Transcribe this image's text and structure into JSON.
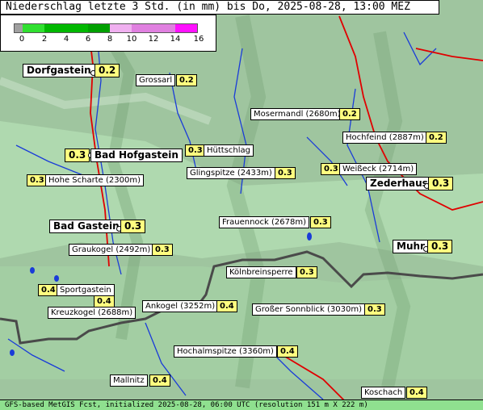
{
  "title": "Niederschlag letzte 3 Std. (in mm) bis Do, 2025-08-28, 13:00 MEZ",
  "legend": {
    "ticks": [
      "0",
      "2",
      "4",
      "6",
      "8",
      "10",
      "12",
      "14",
      "16"
    ],
    "colors": [
      "#a0a0a0",
      "#30e030",
      "#00b800",
      "#00b800",
      "#00a000",
      "#f0b0f0",
      "#e080e0",
      "#e080e0",
      "#ff10ff"
    ]
  },
  "places": [
    {
      "name": "Dorfgastein",
      "value": "0.2"
    },
    {
      "name": "Bad Hofgastein",
      "value": "0.3"
    },
    {
      "name": "Bad Gastein",
      "value": "0.3"
    },
    {
      "name": "Zederhaus",
      "value": "0.3"
    },
    {
      "name": "Muhr",
      "value": "0.3"
    }
  ],
  "peaks": [
    {
      "name": "Grossarl",
      "value": "0.2"
    },
    {
      "name": "Mosermandl (2680m)",
      "value": "0.2"
    },
    {
      "name": "Hochfeind (2887m)",
      "value": "0.2"
    },
    {
      "name": "Hüttschlag",
      "value": "0.3"
    },
    {
      "name": "Hohe Scharte (2300m)",
      "value": "0.3"
    },
    {
      "name": "Glingspitze (2433m)",
      "value": "0.3"
    },
    {
      "name": "Weißeck (2714m)",
      "value": "0.3"
    },
    {
      "name": "Frauennock (2678m)",
      "value": "0.3"
    },
    {
      "name": "Graukogel (2492m)",
      "value": "0.3"
    },
    {
      "name": "Kölnbreinsperre",
      "value": "0.3"
    },
    {
      "name": "Sportgastein",
      "value": "0.4"
    },
    {
      "name": "Kreuzkogel (2688m)",
      "value": "0.4"
    },
    {
      "name": "Ankogel (3252m)",
      "value": "0.4"
    },
    {
      "name": "Großer Sonnblick (3030m)",
      "value": "0.3"
    },
    {
      "name": "Hochalmspitze (3360m)",
      "value": "0.4"
    },
    {
      "name": "Mallnitz",
      "value": "0.4"
    },
    {
      "name": "Koschach",
      "value": "0.4"
    }
  ],
  "footer": "GFS-based MetGIS Fcst, initialized 2025-08-28, 06:00 UTC  (resolution 151 m X 222 m)"
}
